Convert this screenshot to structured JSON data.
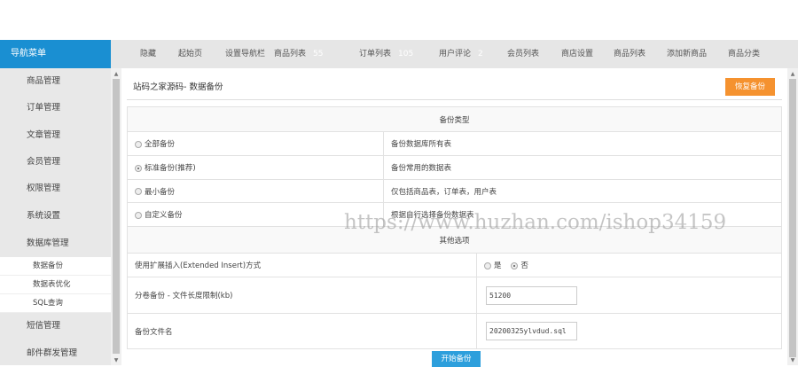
{
  "sidebar": {
    "title": "导航菜单",
    "items": [
      "商品管理",
      "订单管理",
      "文章管理",
      "会员管理",
      "权限管理",
      "系统设置",
      "数据库管理"
    ],
    "subitems": [
      "数据备份",
      "数据表优化",
      "SQL查询"
    ],
    "items_after": [
      "短信管理",
      "邮件群发管理"
    ]
  },
  "topnav": [
    {
      "label": "隐藏"
    },
    {
      "label": "起始页"
    },
    {
      "label": "设置导航栏"
    },
    {
      "label": "商品列表",
      "count": "55"
    },
    {
      "label": "订单列表",
      "count": "105"
    },
    {
      "label": "用户评论",
      "count": "2"
    },
    {
      "label": "会员列表"
    },
    {
      "label": "商店设置"
    },
    {
      "label": "商品列表"
    },
    {
      "label": "添加新商品"
    },
    {
      "label": "商品分类"
    }
  ],
  "main": {
    "title": "站码之家源码- 数据备份",
    "restore_button": "恢复备份",
    "backup_type_header": "备份类型",
    "backup_types": [
      {
        "label": "全部备份",
        "desc": "备份数据库所有表",
        "checked": false
      },
      {
        "label": "标准备份(推荐)",
        "desc": "备份常用的数据表",
        "checked": true
      },
      {
        "label": "最小备份",
        "desc": "仅包括商品表，订单表，用户表",
        "checked": false
      },
      {
        "label": "自定义备份",
        "desc": "根据自行选择备份数据表",
        "checked": false
      }
    ],
    "other_header": "其他选项",
    "extended_insert": {
      "label": "使用扩展插入(Extended Insert)方式",
      "yes": "是",
      "no": "否",
      "value": "否"
    },
    "volume_size": {
      "label": "分卷备份 - 文件长度限制(kb)",
      "value": "51200"
    },
    "file_name": {
      "label": "备份文件名",
      "value": "20200325ylvdud.sql"
    },
    "start_button": "开始备份"
  },
  "watermark": "https://www.huzhan.com/ishop34159"
}
